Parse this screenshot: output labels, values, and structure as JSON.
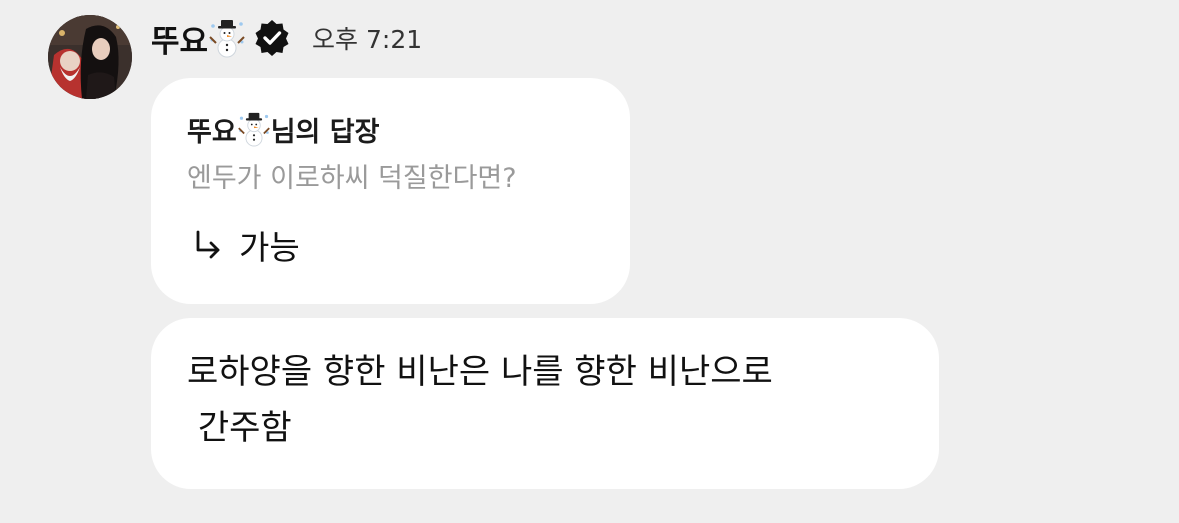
{
  "header": {
    "username": "뚜요",
    "username_emoji_icon": "snowman-icon",
    "verified_icon": "verified-badge-icon",
    "timestamp": "오후 7:21"
  },
  "reply": {
    "title_name": "뚜요",
    "title_emoji_icon": "snowman-icon",
    "title_suffix": "님의 답장",
    "quoted_text": "엔두가 이로하씨 덕질한다면?",
    "arrow_icon": "return-arrow-icon",
    "answer": "가능"
  },
  "message": {
    "text": "로하양을 향한 비난은 나를 향한 비난으로\n 간주함"
  },
  "colors": {
    "background": "#efefef",
    "bubble": "#ffffff",
    "primary_text": "#111111",
    "secondary_text": "#9a9a9a"
  }
}
